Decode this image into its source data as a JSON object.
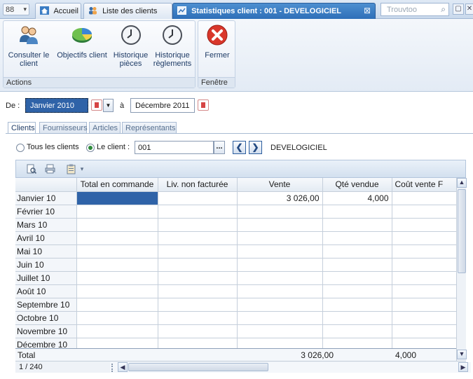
{
  "tabs": {
    "accueil": "Accueil",
    "liste_clients": "Liste des clients",
    "active": "Statistiques client : 001 - DEVELOGICIEL",
    "close": "⊠"
  },
  "search": {
    "placeholder": "Trouvtoo"
  },
  "ribbon": {
    "actions": {
      "label": "Actions",
      "consulter_line1": "Consulter le",
      "consulter_line2": "client",
      "objectifs": "Objectifs client",
      "hist_pieces_line1": "Historique",
      "hist_pieces_line2": "pièces",
      "hist_reg_line1": "Historique",
      "hist_reg_line2": "règlements"
    },
    "fenetre": {
      "label": "Fenêtre",
      "fermer": "Fermer"
    }
  },
  "period": {
    "from_label": "De :",
    "from_value": "Janvier 2010",
    "to_label": "à",
    "to_value": "Décembre 2011"
  },
  "inner_tabs": [
    "Clients",
    "Fournisseurs",
    "Articles",
    "Représentants"
  ],
  "filter": {
    "all_label": "Tous les clients",
    "client_label": "Le client :",
    "client_code": "001",
    "ellipsis": "...",
    "prev": "❮",
    "next": "❯",
    "client_name": "DEVELOGICIEL"
  },
  "grid": {
    "columns": [
      "Total en commande",
      "Liv. non facturée",
      "Vente",
      "Qté vendue",
      "Coût vente F"
    ],
    "rows": [
      {
        "label": "Janvier 10",
        "vente": "3 026,00",
        "qte": "4,000"
      },
      {
        "label": "Février 10",
        "vente": "",
        "qte": ""
      },
      {
        "label": "Mars 10",
        "vente": "",
        "qte": ""
      },
      {
        "label": "Avril 10",
        "vente": "",
        "qte": ""
      },
      {
        "label": "Mai 10",
        "vente": "",
        "qte": ""
      },
      {
        "label": "Juin 10",
        "vente": "",
        "qte": ""
      },
      {
        "label": "Juillet 10",
        "vente": "",
        "qte": ""
      },
      {
        "label": "Août 10",
        "vente": "",
        "qte": ""
      },
      {
        "label": "Septembre 10",
        "vente": "",
        "qte": ""
      },
      {
        "label": "Octobre 10",
        "vente": "",
        "qte": ""
      },
      {
        "label": "Novembre 10",
        "vente": "",
        "qte": ""
      },
      {
        "label": "Décembre 10",
        "vente": "",
        "qte": ""
      }
    ],
    "total": {
      "label": "Total",
      "vente": "3 026,00",
      "qte": "4,000"
    },
    "record_count": "1 / 240"
  },
  "colors": {
    "accent": "#2f63a8",
    "active_tab": "#3a7cc4",
    "close_red": "#d9372b"
  }
}
